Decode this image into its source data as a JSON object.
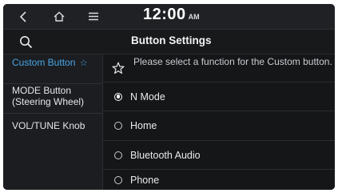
{
  "status_bar": {
    "time": "12:00",
    "ampm": "AM",
    "icons": [
      "back-icon",
      "home-icon",
      "menu-icon"
    ]
  },
  "title_bar": {
    "title": "Button Settings",
    "icons": [
      "search-icon"
    ]
  },
  "left_menu": {
    "items": [
      {
        "label": "Custom Button",
        "suffix": "☆",
        "active": true
      },
      {
        "label": "MODE Button (Steering Wheel)",
        "active": false
      },
      {
        "label": "VOL/TUNE Knob",
        "active": false
      }
    ],
    "active_color": "#4aa6e8"
  },
  "options": {
    "note": "Please select a function for the Custom button.",
    "note_icon": "star-outline-icon",
    "items": [
      {
        "label": "N Mode",
        "selected": true
      },
      {
        "label": "Home",
        "selected": false
      },
      {
        "label": "Bluetooth Audio",
        "selected": false
      },
      {
        "label": "Phone",
        "selected": false
      }
    ]
  }
}
